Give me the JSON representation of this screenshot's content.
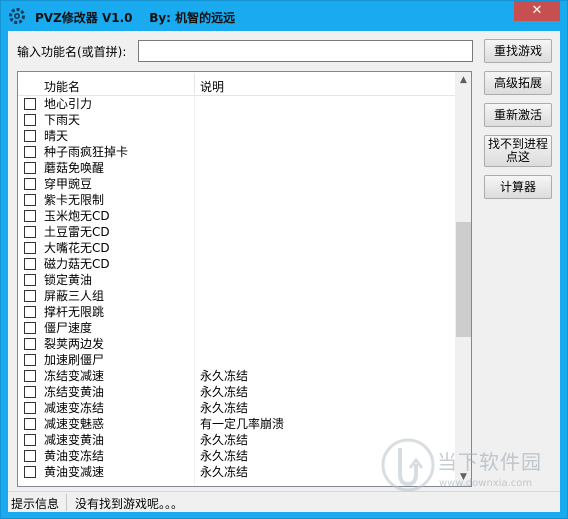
{
  "window": {
    "title": "PVZ修改器 V1.0    By: 机智的远远",
    "close_label": "✕"
  },
  "search": {
    "label": "输入功能名(或首拼):",
    "value": "",
    "placeholder": ""
  },
  "buttons": {
    "refind": "重找游戏",
    "advanced": "高级拓展",
    "reactivate": "重新激活",
    "cannot_find": "找不到进程点这",
    "calculator": "计算器"
  },
  "list": {
    "columns": [
      "功能名",
      "说明"
    ],
    "rows": [
      {
        "name": "地心引力",
        "desc": "",
        "checked": false
      },
      {
        "name": "下雨天",
        "desc": "",
        "checked": false
      },
      {
        "name": "晴天",
        "desc": "",
        "checked": false
      },
      {
        "name": "种子雨疯狂掉卡",
        "desc": "",
        "checked": false
      },
      {
        "name": "蘑菇免唤醒",
        "desc": "",
        "checked": false
      },
      {
        "name": "穿甲豌豆",
        "desc": "",
        "checked": false
      },
      {
        "name": "紫卡无限制",
        "desc": "",
        "checked": false
      },
      {
        "name": "玉米炮无CD",
        "desc": "",
        "checked": false
      },
      {
        "name": "土豆雷无CD",
        "desc": "",
        "checked": false
      },
      {
        "name": "大嘴花无CD",
        "desc": "",
        "checked": false
      },
      {
        "name": "磁力菇无CD",
        "desc": "",
        "checked": false
      },
      {
        "name": "锁定黄油",
        "desc": "",
        "checked": false
      },
      {
        "name": "屏蔽三人组",
        "desc": "",
        "checked": false
      },
      {
        "name": "撑杆无限跳",
        "desc": "",
        "checked": false
      },
      {
        "name": "僵尸速度",
        "desc": "",
        "checked": false
      },
      {
        "name": "裂荚两边发",
        "desc": "",
        "checked": false
      },
      {
        "name": "加速刷僵尸",
        "desc": "",
        "checked": false
      },
      {
        "name": "冻结变减速",
        "desc": "永久冻结",
        "checked": false
      },
      {
        "name": "冻结变黄油",
        "desc": "永久冻结",
        "checked": false
      },
      {
        "name": "减速变冻结",
        "desc": "永久冻结",
        "checked": false
      },
      {
        "name": "减速变魅惑",
        "desc": "有一定几率崩溃",
        "checked": false
      },
      {
        "name": "减速变黄油",
        "desc": "永久冻结",
        "checked": false
      },
      {
        "name": "黄油变冻结",
        "desc": "永久冻结",
        "checked": false
      },
      {
        "name": "黄油变减速",
        "desc": "永久冻结",
        "checked": false
      }
    ]
  },
  "status": {
    "label": "提示信息",
    "message": "没有找到游戏呢。。。"
  },
  "watermark": {
    "main": "当下软件园",
    "sub": "www.downxia.com"
  },
  "colors": {
    "titlebar": "#19aaf0",
    "close": "#c74f4f",
    "client": "#f0f0f0"
  },
  "icons": {
    "app": "gear-icon",
    "scroll_up": "chevron-up-icon",
    "scroll_down": "chevron-down-icon"
  }
}
